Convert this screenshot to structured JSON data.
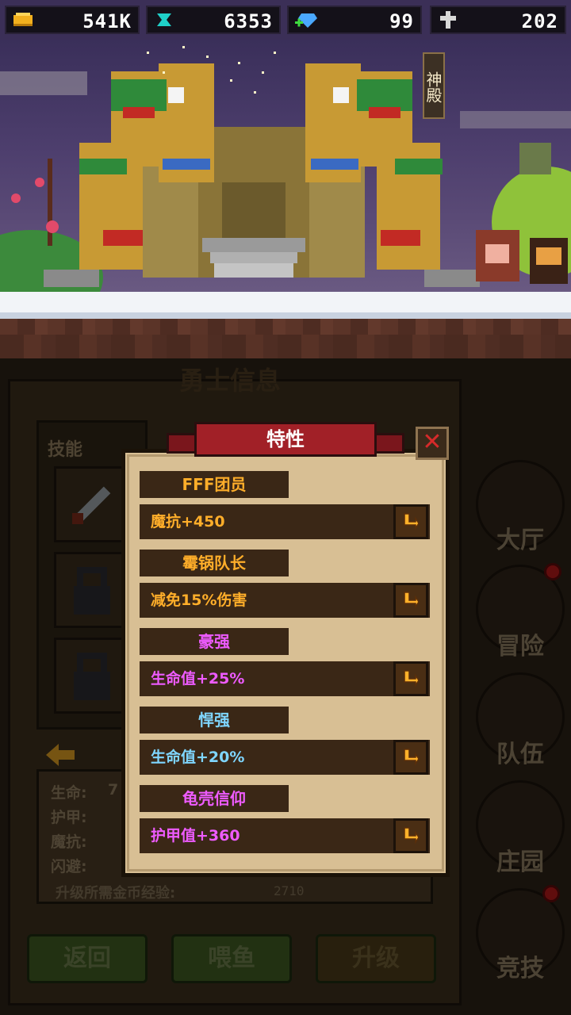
{
  "currency": {
    "gold": "541K",
    "gem": "6353",
    "diamond": "99",
    "cross": "202"
  },
  "scene": {
    "temple_sign": "神殿"
  },
  "panel": {
    "title": "勇士信息",
    "skills_label": "技能",
    "stats": [
      "生命:",
      "护甲:",
      "魔抗:",
      "闪避:"
    ],
    "stat_partial": "7",
    "upgrade_label": "升级所需金币经验:",
    "upgrade_value": "2710",
    "buttons": {
      "back": "返回",
      "feed": "喂鱼",
      "upgrade": "升级"
    }
  },
  "nav": {
    "hall": "大厅",
    "adventure": "冒险",
    "team": "队伍",
    "manor": "庄园",
    "arena": "竞技"
  },
  "modal": {
    "title": "特性",
    "close": "✕",
    "traits": [
      {
        "name": "FFF团员",
        "effect": "魔抗+450",
        "color": "orange"
      },
      {
        "name": "霉锅队长",
        "effect": "减免15%伤害",
        "color": "orange"
      },
      {
        "name": "豪强",
        "effect": "生命值+25%",
        "color": "purple"
      },
      {
        "name": "悍强",
        "effect": "生命值+20%",
        "color": "blue"
      },
      {
        "name": "龟壳信仰",
        "effect": "护甲值+360",
        "color": "purple"
      }
    ]
  },
  "colors": {
    "orange": "#ffae2a",
    "purple": "#ee5bff",
    "blue": "#7fd6ff",
    "title_red": "#a12027"
  }
}
